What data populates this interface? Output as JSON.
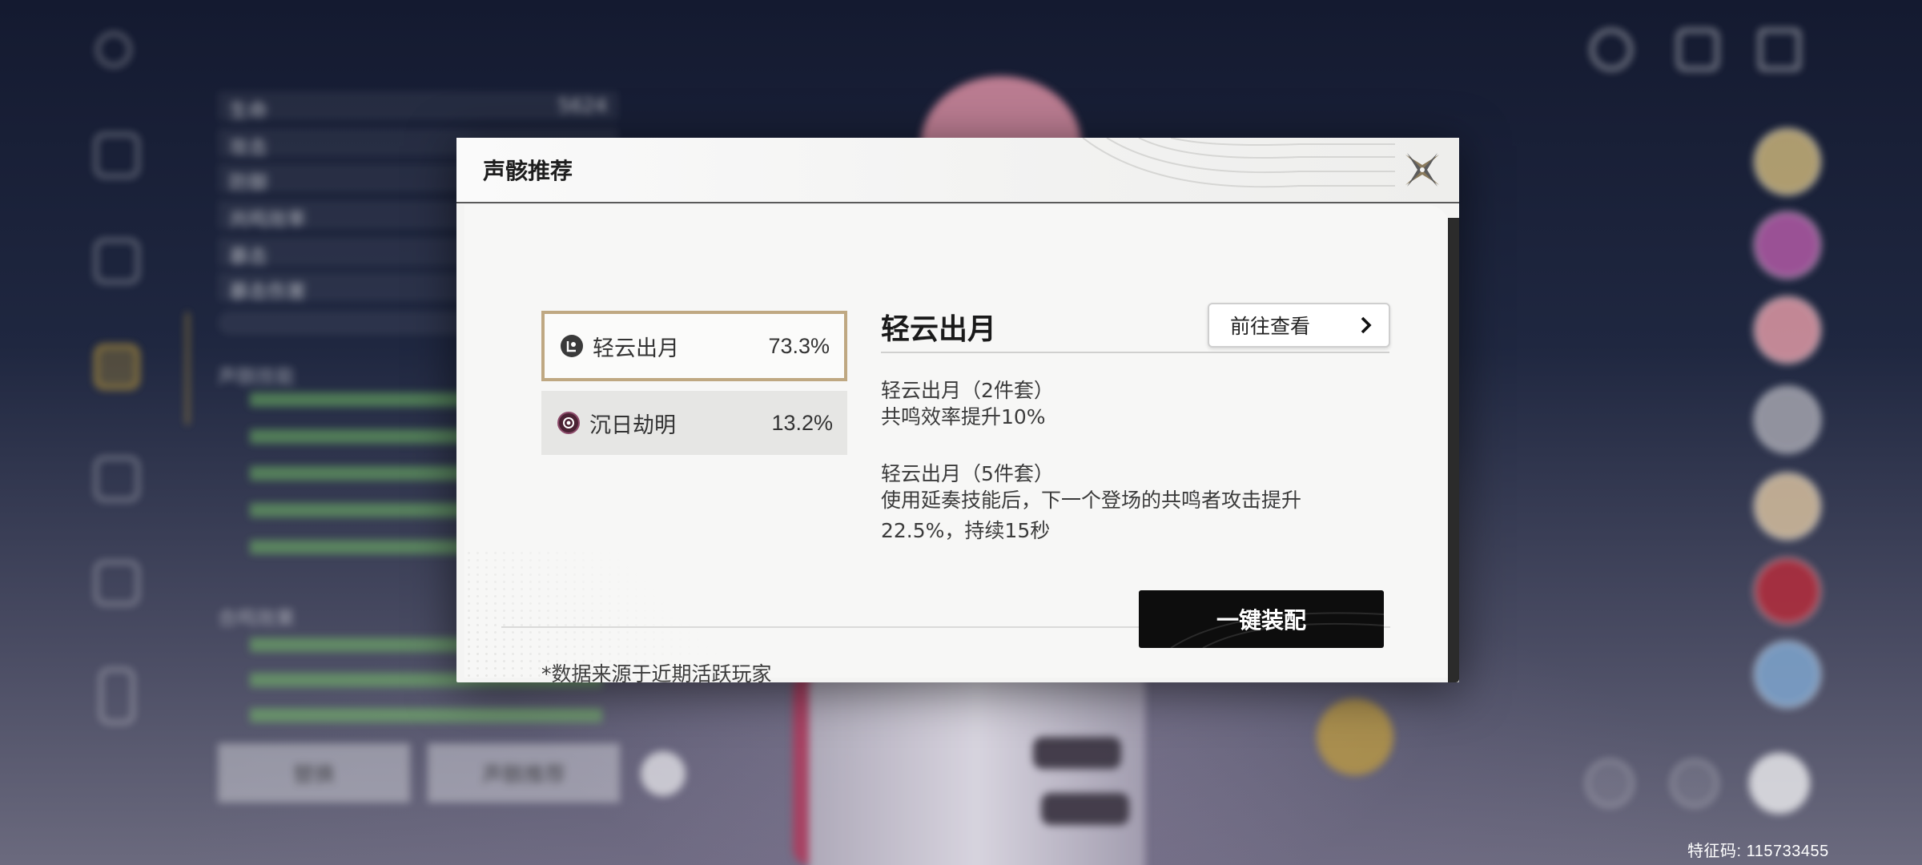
{
  "background": {
    "stats": [
      "生命",
      "攻击",
      "防御",
      "共鸣效率",
      "暴击",
      "暴击伤害"
    ],
    "life_value": "5624",
    "section_echo_skill": "声骸技能",
    "section_sonata": "合鸣效果",
    "buttons": [
      "替换",
      "声骸推荐"
    ],
    "uid_label": "特征码: 115733455"
  },
  "modal": {
    "title": "声骸推荐",
    "close_icon": "close-x-icon",
    "sets": [
      {
        "name": "轻云出月",
        "percent": "73.3%",
        "icon": "moon-cloud-icon",
        "selected": true
      },
      {
        "name": "沉日劫明",
        "percent": "13.2%",
        "icon": "swirl-sun-icon",
        "selected": false
      }
    ],
    "detail": {
      "title": "轻云出月",
      "goto_label": "前往查看",
      "effect2_title": "轻云出月（2件套）",
      "effect2_text": "共鸣效率提升10%",
      "effect5_title": "轻云出月（5件套）",
      "effect5_text": "使用延奏技能后，下一个登场的共鸣者攻击提升22.5%，持续15秒"
    },
    "source_note": "*数据来源于近期活跃玩家",
    "equip_label": "一键装配"
  },
  "colors": {
    "selected_border": "#bfa882",
    "equip_button": "#0d0d0d",
    "green_text": "#7ed36a",
    "gold_accent": "#c9a33b"
  }
}
